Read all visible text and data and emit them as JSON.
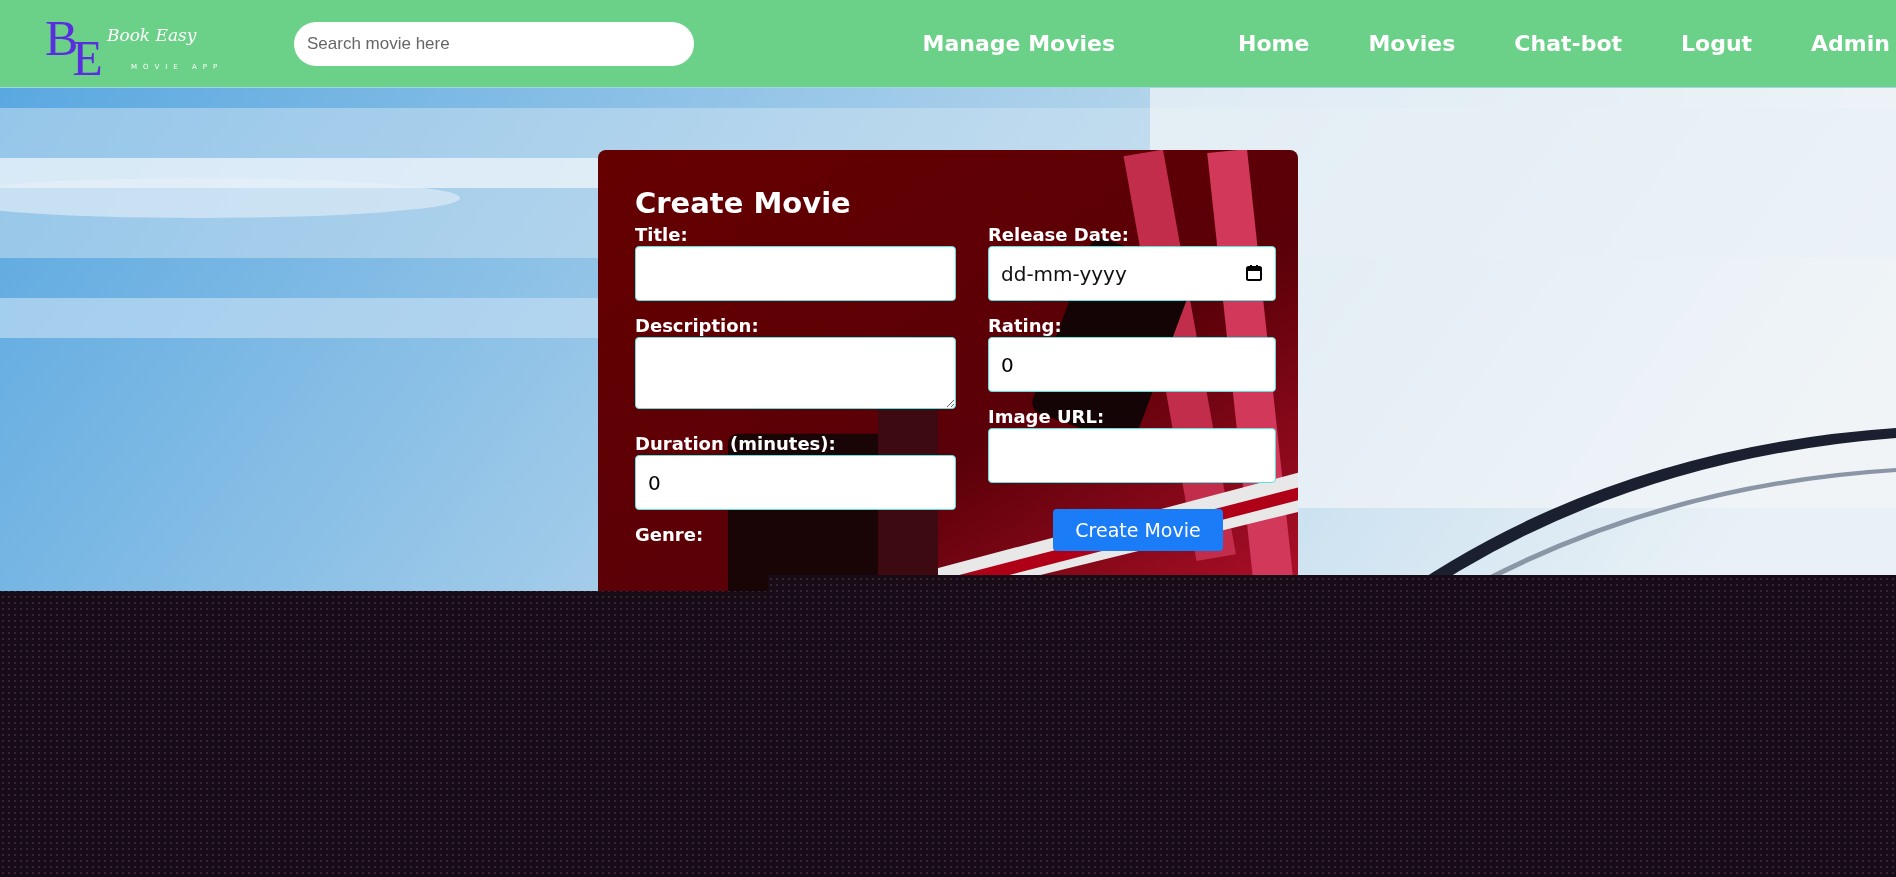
{
  "header": {
    "logo": {
      "initial_1": "B",
      "initial_2": "E",
      "script": "Book Easy",
      "tagline": "MOVIE APP"
    },
    "search": {
      "placeholder": "Search movie here"
    },
    "nav": [
      {
        "label": "Manage Movies"
      },
      {
        "label": "Home"
      },
      {
        "label": "Movies"
      },
      {
        "label": "Chat-bot"
      },
      {
        "label": "Logut"
      },
      {
        "label": "Admin"
      }
    ]
  },
  "form": {
    "title": "Create Movie",
    "columns": [
      [
        {
          "kind": "text",
          "label": "Title:"
        },
        {
          "kind": "textarea",
          "label": "Description:"
        },
        {
          "kind": "number",
          "label": "Duration (minutes):",
          "value": "0"
        },
        {
          "kind": "label",
          "label": "Genre:"
        }
      ],
      [
        {
          "kind": "date",
          "label": "Release Date:",
          "placeholder": "dd-mm-yyyy"
        },
        {
          "kind": "number",
          "label": "Rating:",
          "value": "0"
        },
        {
          "kind": "text",
          "label": "Image URL:"
        }
      ]
    ],
    "submit": "Create Movie"
  }
}
